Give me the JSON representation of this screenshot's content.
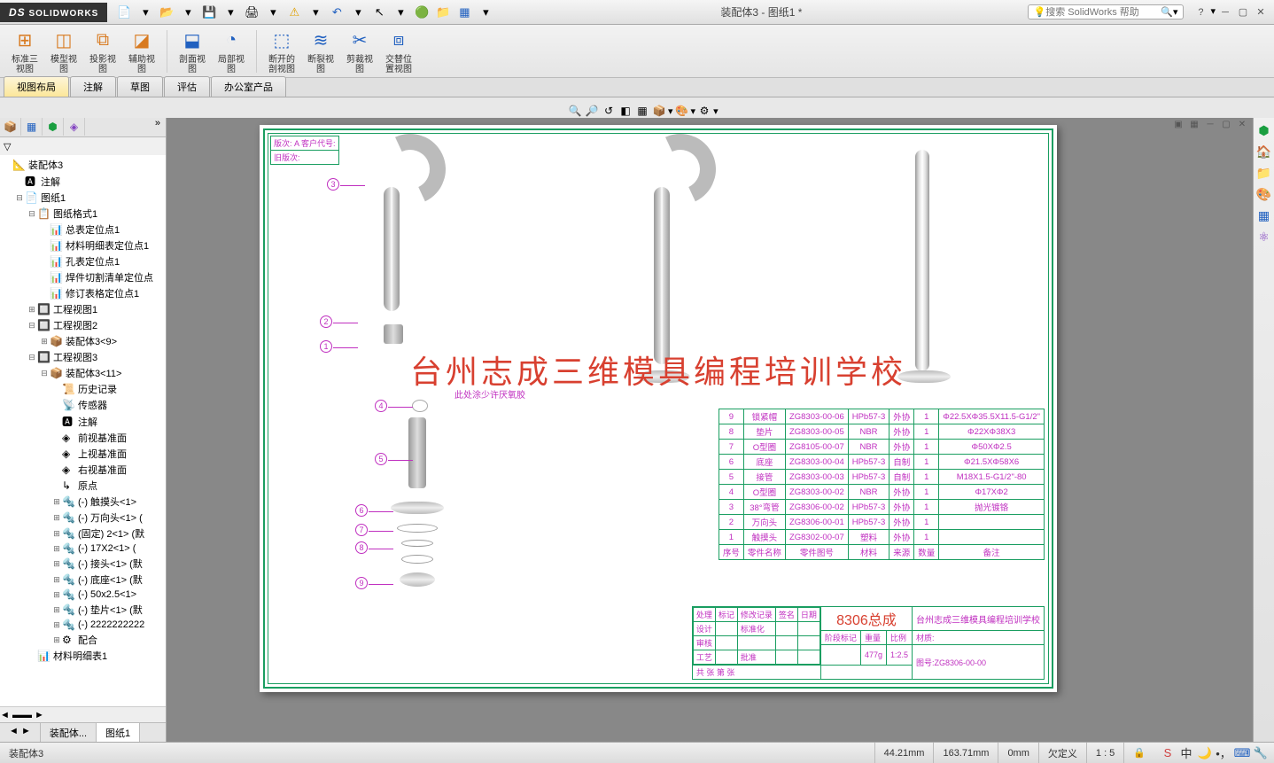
{
  "app": {
    "title": "装配体3 - 图纸1 *",
    "logo": "SOLIDWORKS"
  },
  "search": {
    "placeholder": "搜索 SolidWorks 帮助"
  },
  "ribbon": [
    {
      "l": "标准三视图"
    },
    {
      "l": "模型视图"
    },
    {
      "l": "投影视图"
    },
    {
      "l": "辅助视图"
    },
    {
      "l": "剖面视图"
    },
    {
      "l": "局部视图"
    },
    {
      "l": "断开的剖视图"
    },
    {
      "l": "断裂视图"
    },
    {
      "l": "剪裁视图"
    },
    {
      "l": "交替位置视图"
    }
  ],
  "tabs": [
    "视图布局",
    "注解",
    "草图",
    "评估",
    "办公室产品"
  ],
  "tree": [
    {
      "d": 0,
      "e": "",
      "i": "📐",
      "t": "装配体3"
    },
    {
      "d": 1,
      "e": "",
      "i": "🅰",
      "t": "注解"
    },
    {
      "d": 1,
      "e": "⊟",
      "i": "📄",
      "t": "图纸1"
    },
    {
      "d": 2,
      "e": "⊟",
      "i": "📋",
      "t": "图纸格式1"
    },
    {
      "d": 3,
      "e": "",
      "i": "📊",
      "t": "总表定位点1"
    },
    {
      "d": 3,
      "e": "",
      "i": "📊",
      "t": "材料明细表定位点1"
    },
    {
      "d": 3,
      "e": "",
      "i": "📊",
      "t": "孔表定位点1"
    },
    {
      "d": 3,
      "e": "",
      "i": "📊",
      "t": "焊件切割清单定位点"
    },
    {
      "d": 3,
      "e": "",
      "i": "📊",
      "t": "修订表格定位点1"
    },
    {
      "d": 2,
      "e": "⊞",
      "i": "🔲",
      "t": "工程视图1"
    },
    {
      "d": 2,
      "e": "⊟",
      "i": "🔲",
      "t": "工程视图2"
    },
    {
      "d": 3,
      "e": "⊞",
      "i": "📦",
      "t": "装配体3<9>"
    },
    {
      "d": 2,
      "e": "⊟",
      "i": "🔲",
      "t": "工程视图3"
    },
    {
      "d": 3,
      "e": "⊟",
      "i": "📦",
      "t": "装配体3<11>"
    },
    {
      "d": 4,
      "e": "",
      "i": "📜",
      "t": "历史记录"
    },
    {
      "d": 4,
      "e": "",
      "i": "📡",
      "t": "传感器"
    },
    {
      "d": 4,
      "e": "",
      "i": "🅰",
      "t": "注解"
    },
    {
      "d": 4,
      "e": "",
      "i": "◈",
      "t": "前视基准面"
    },
    {
      "d": 4,
      "e": "",
      "i": "◈",
      "t": "上视基准面"
    },
    {
      "d": 4,
      "e": "",
      "i": "◈",
      "t": "右视基准面"
    },
    {
      "d": 4,
      "e": "",
      "i": "↳",
      "t": "原点"
    },
    {
      "d": 4,
      "e": "⊞",
      "i": "🔩",
      "t": "(-) 触摸头<1>"
    },
    {
      "d": 4,
      "e": "⊞",
      "i": "🔩",
      "t": "(-) 万向头<1> ("
    },
    {
      "d": 4,
      "e": "⊞",
      "i": "🔩",
      "t": "(固定) 2<1> (默"
    },
    {
      "d": 4,
      "e": "⊞",
      "i": "🔩",
      "t": "(-) 17X2<1> ("
    },
    {
      "d": 4,
      "e": "⊞",
      "i": "🔩",
      "t": "(-) 接头<1> (默"
    },
    {
      "d": 4,
      "e": "⊞",
      "i": "🔩",
      "t": "(-) 底座<1> (默"
    },
    {
      "d": 4,
      "e": "⊞",
      "i": "🔩",
      "t": "(-) 50x2.5<1>"
    },
    {
      "d": 4,
      "e": "⊞",
      "i": "🔩",
      "t": "(-) 垫片<1> (默"
    },
    {
      "d": 4,
      "e": "⊞",
      "i": "🔩",
      "t": "(-) 2222222222"
    },
    {
      "d": 4,
      "e": "⊞",
      "i": "⚙",
      "t": "配合"
    },
    {
      "d": 2,
      "e": "",
      "i": "📊",
      "t": "材料明细表1"
    }
  ],
  "sheet_tabs": [
    "装配体...",
    "图纸1"
  ],
  "drawing": {
    "hdr1": "版次:  A   客户代号:",
    "hdr2": "旧版次:",
    "watermark": "台州志成三维模具编程培训学校",
    "note": "此处涂少许厌氧胶",
    "balloons": [
      "1",
      "2",
      "3",
      "4",
      "5",
      "6",
      "7",
      "8",
      "9"
    ]
  },
  "bom_hdr": [
    "序号",
    "零件名称",
    "零件图号",
    "材料",
    "来源",
    "数量",
    "备注"
  ],
  "bom": [
    [
      "9",
      "锁紧帽",
      "ZG8303-00-06",
      "HPb57-3",
      "外协",
      "1",
      "Φ22.5XΦ35.5X11.5-G1/2\""
    ],
    [
      "8",
      "垫片",
      "ZG8303-00-05",
      "NBR",
      "外协",
      "1",
      "Φ22XΦ38X3"
    ],
    [
      "7",
      "O型圈",
      "ZG8105-00-07",
      "NBR",
      "外协",
      "1",
      "Φ50XΦ2.5"
    ],
    [
      "6",
      "底座",
      "ZG8303-00-04",
      "HPb57-3",
      "自制",
      "1",
      "Φ21.5XΦ58X6"
    ],
    [
      "5",
      "接管",
      "ZG8303-00-03",
      "HPb57-3",
      "自制",
      "1",
      "M18X1.5-G1/2\"-80"
    ],
    [
      "4",
      "O型圈",
      "ZG8303-00-02",
      "NBR",
      "外协",
      "1",
      "Φ17XΦ2"
    ],
    [
      "3",
      "38°弯管",
      "ZG8306-00-02",
      "HPb57-3",
      "外协",
      "1",
      "抛光镀铬"
    ],
    [
      "2",
      "万向头",
      "ZG8306-00-01",
      "HPb57-3",
      "外协",
      "1",
      ""
    ],
    [
      "1",
      "触摸头",
      "ZG8302-00-07",
      "塑料",
      "外协",
      "1",
      ""
    ]
  ],
  "tb": {
    "name": "8306总成",
    "school": "台州志成三维模具编程培训学校",
    "rows_l": [
      [
        "处理",
        "标记",
        "修改记录",
        "签名",
        "日期"
      ],
      [
        "设计",
        "",
        "标准化",
        "",
        ""
      ],
      [
        "审核",
        "",
        "",
        "",
        ""
      ],
      [
        "工艺",
        "",
        "批准",
        "",
        ""
      ]
    ],
    "stage": "阶段标记",
    "weight_l": "重量",
    "weight": "477g",
    "scale_l": "比例",
    "scale": "1:2.5",
    "mat_l": "材质:",
    "dwg_l": "图号:",
    "dwg": "ZG8306-00-00",
    "sheet": "共  张  第  张"
  },
  "status": {
    "doc": "装配体3",
    "x": "44.21mm",
    "y": "163.71mm",
    "z": "0mm",
    "state": "欠定义",
    "ratio": "1 : 5"
  }
}
